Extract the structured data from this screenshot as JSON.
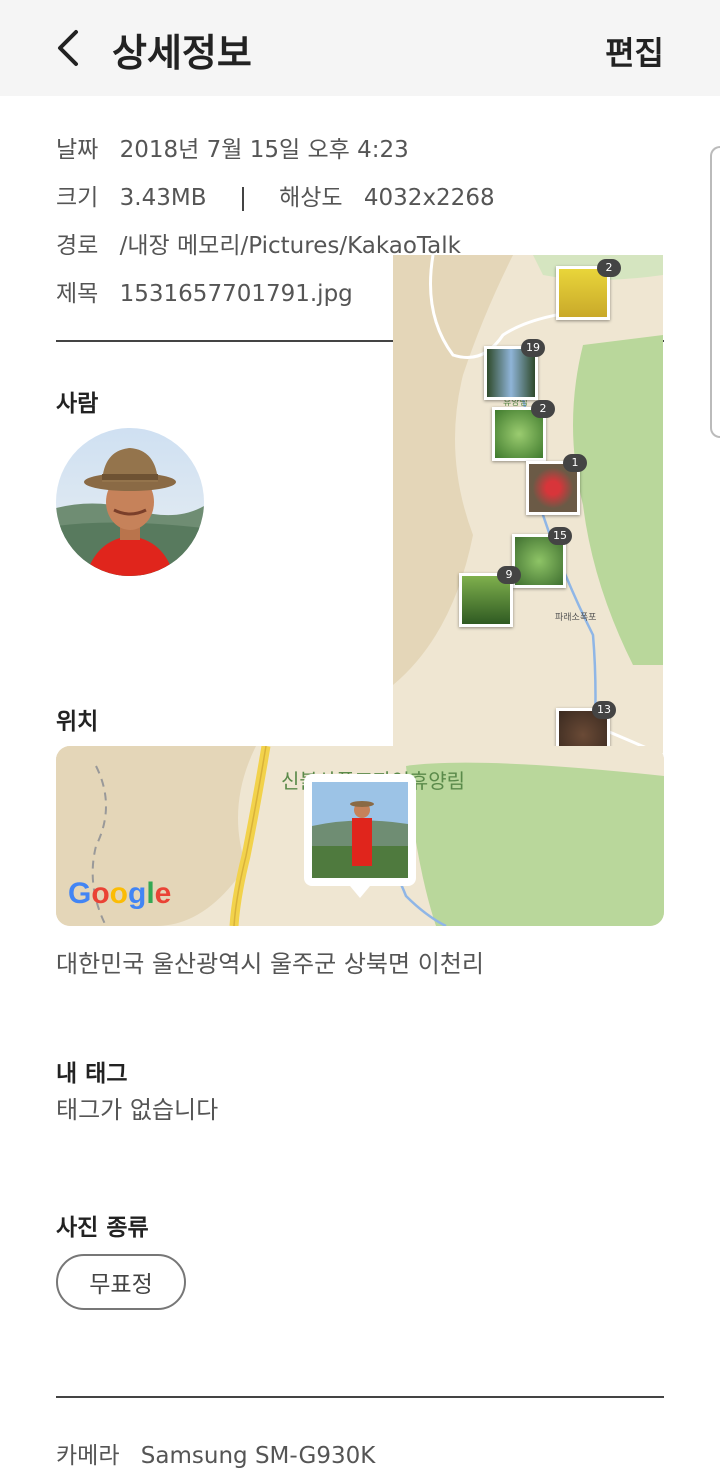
{
  "header": {
    "title": "상세정보",
    "edit_label": "편집"
  },
  "details": {
    "date_label": "날짜",
    "date_value": "2018년 7월 15일 오후 4:23",
    "size_label": "크기",
    "size_value": "3.43MB",
    "resolution_label": "해상도",
    "resolution_value": "4032x2268",
    "path_label": "경로",
    "path_value": "/내장 메모리/Pictures/KakaoTalk",
    "name_label": "제목",
    "name_value": "1531657701791.jpg"
  },
  "people": {
    "title": "사람"
  },
  "overlay_map": {
    "place_label": "휴양림",
    "place_label_2": "파래소폭포",
    "badges": [
      "2",
      "19",
      "2",
      "1",
      "15",
      "9",
      "13"
    ]
  },
  "location": {
    "title": "위치",
    "map_label": "신불산폭포자연휴양림",
    "google_logo": "Google",
    "address": "대한민국 울산광역시 울주군 상북면 이천리"
  },
  "tags": {
    "title": "내 태그",
    "empty_text": "태그가 없습니다"
  },
  "photo_type": {
    "title": "사진 종류",
    "chip_label": "무표정"
  },
  "camera": {
    "label": "카메라",
    "value": "Samsung SM-G930K"
  },
  "colors": {
    "appbar_bg": "#f5f5f5",
    "map_bg": "#ece3cf",
    "forest_green": "#b9d79b",
    "road_yellow": "#f2d24b"
  }
}
